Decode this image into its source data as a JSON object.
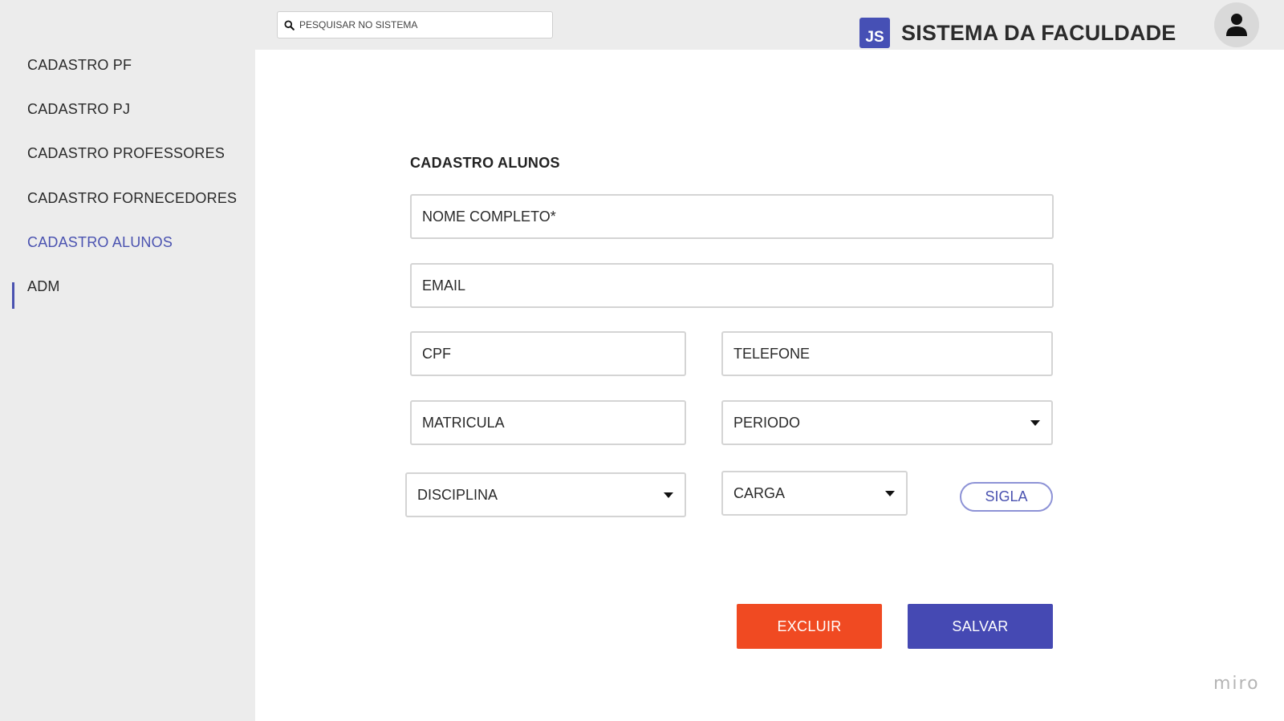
{
  "header": {
    "search_placeholder": "PESQUISAR NO SISTEMA",
    "brand_logo_text": "JS",
    "brand_title": "SISTEMA DA FACULDADE"
  },
  "sidebar": {
    "items": [
      {
        "label": "CADASTRO PF",
        "active": false
      },
      {
        "label": "CADASTRO PJ",
        "active": false
      },
      {
        "label": "CADASTRO PROFESSORES",
        "active": false
      },
      {
        "label": "CADASTRO FORNECEDORES",
        "active": false
      },
      {
        "label": "CADASTRO ALUNOS",
        "active": true
      },
      {
        "label": "ADM",
        "active": false
      }
    ]
  },
  "form": {
    "title": "CADASTRO ALUNOS",
    "nome_placeholder": "NOME COMPLETO*",
    "email_placeholder": "EMAIL",
    "cpf_placeholder": "CPF",
    "telefone_placeholder": "TELEFONE",
    "matricula_placeholder": "MATRICULA",
    "periodo_label": "PERIODO",
    "disciplina_label": "DISCIPLINA",
    "carga_label": "CARGA",
    "sigla_label": "SIGLA"
  },
  "actions": {
    "delete_label": "EXCLUIR",
    "save_label": "SALVAR"
  },
  "watermark": "miro",
  "colors": {
    "accent": "#4a52b0",
    "delete": "#f04a22",
    "save": "#4549b3"
  }
}
